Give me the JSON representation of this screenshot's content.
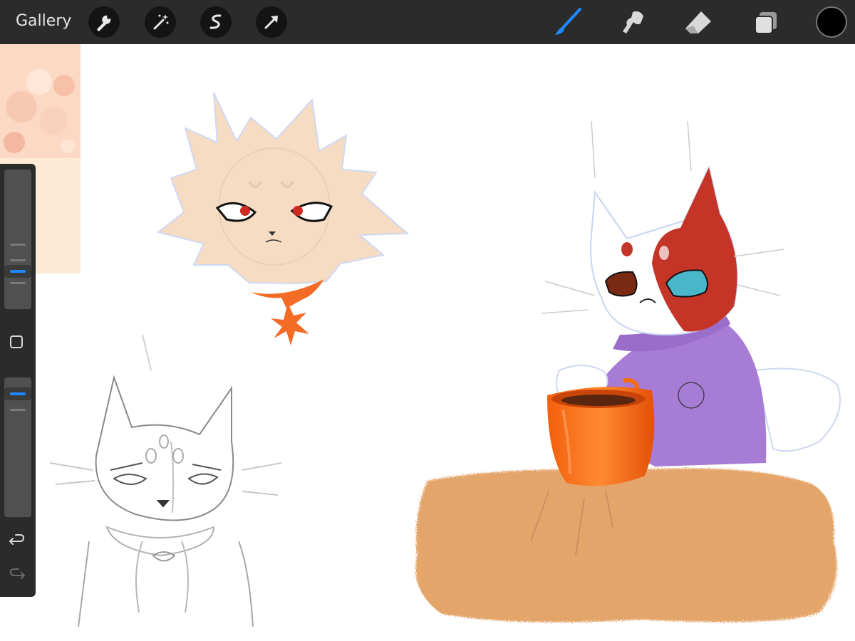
{
  "app": {
    "gallery_label": "Gallery"
  },
  "toolbar": {
    "left_tools": [
      "wrench-icon",
      "magic-wand-icon",
      "selection-icon",
      "transform-arrow-icon"
    ],
    "right_tools": [
      "brush-icon",
      "smudge-icon",
      "eraser-icon",
      "layers-icon"
    ],
    "active_tool": "brush-icon",
    "active_color": "#000000",
    "accent_color": "#1e88ff"
  },
  "sidebar": {
    "brush_size_level": 0.25,
    "opacity_level": 0.92,
    "modify_button": "square-icon",
    "undo": "undo-icon",
    "redo": "redo-icon"
  },
  "colors": {
    "toolbar_bg": "#2b2b2b",
    "canvas_bg": "#ffffff",
    "fluffy_cat_fur": "#f6dcc2",
    "scarf_orange": "#f36b24",
    "mask_red": "#c43527",
    "sweater_purple": "#a77cd4",
    "mug_orange": "#f56d10",
    "table_tan": "#e4a56b"
  }
}
